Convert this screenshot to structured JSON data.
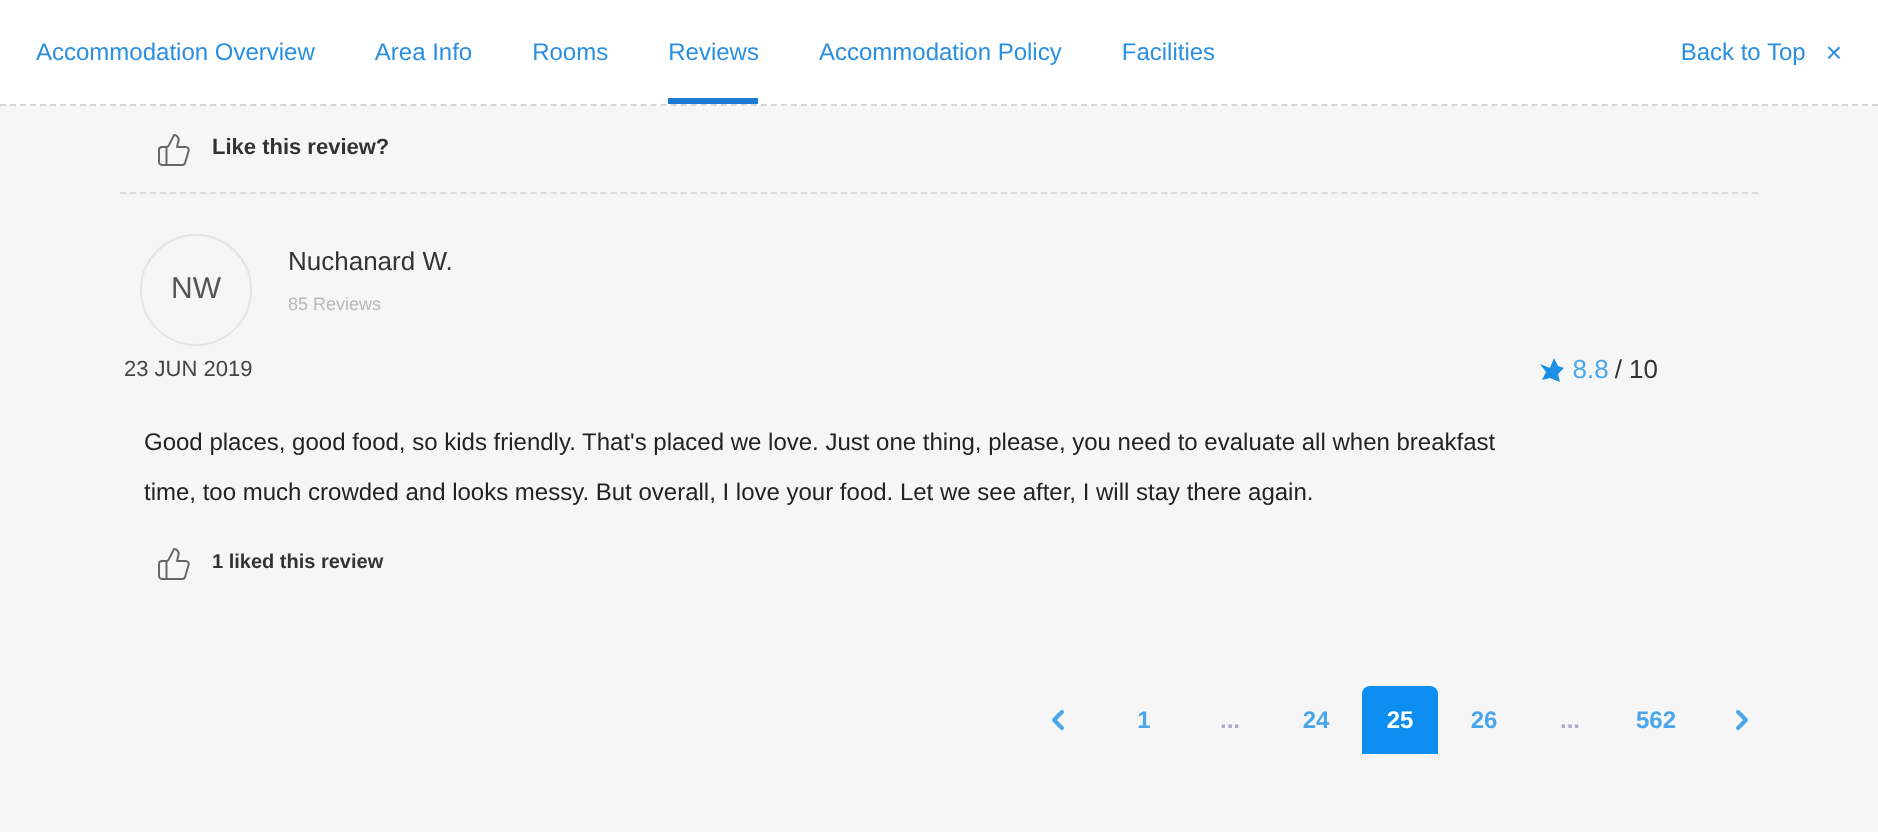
{
  "nav": {
    "tabs": [
      {
        "label": "Accommodation Overview",
        "selected": false
      },
      {
        "label": "Area Info",
        "selected": false
      },
      {
        "label": "Rooms",
        "selected": false
      },
      {
        "label": "Reviews",
        "selected": true
      },
      {
        "label": "Accommodation Policy",
        "selected": false
      },
      {
        "label": "Facilities",
        "selected": false
      }
    ],
    "back_to_top": "Back to Top",
    "close": "×"
  },
  "previous_like": "Like this review?",
  "review": {
    "initials": "NW",
    "name": "Nuchanard W.",
    "review_count": "85 Reviews",
    "date": "23 JUN 2019",
    "score": "8.8",
    "score_max": "/ 10",
    "text": "Good places, good food, so kids friendly. That's placed we love. Just one thing, please, you need to evaluate all when breakfast time, too much crowded and looks messy. But overall, I love your food. Let we see after, I will stay there again.",
    "likes": "1 liked this review"
  },
  "pagination": [
    {
      "kind": "prev"
    },
    {
      "kind": "page",
      "label": "1",
      "selected": false
    },
    {
      "kind": "ellipsis",
      "label": "..."
    },
    {
      "kind": "page",
      "label": "24",
      "selected": false
    },
    {
      "kind": "page",
      "label": "25",
      "selected": true
    },
    {
      "kind": "page",
      "label": "26",
      "selected": false
    },
    {
      "kind": "ellipsis",
      "label": "..."
    },
    {
      "kind": "page",
      "label": "562",
      "selected": false
    },
    {
      "kind": "next"
    }
  ]
}
